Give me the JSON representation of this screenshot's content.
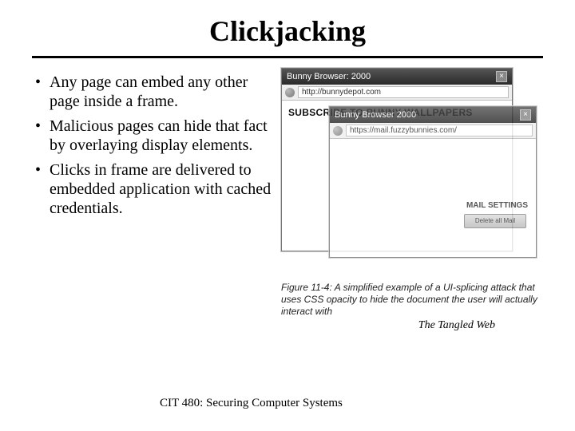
{
  "title": "Clickjacking",
  "bullets": [
    "Any page can embed any other page inside a frame.",
    "Malicious pages can hide that fact by overlaying display elements.",
    "Clicks in frame are delivered to embedded application with cached credentials."
  ],
  "figure": {
    "back_window": {
      "title": "Bunny Browser: 2000",
      "url": "http://bunnydepot.com",
      "headline": "SUBSCRIBE TO BUNNY WALLPAPERS"
    },
    "front_window": {
      "title": "Bunny Browser 2000",
      "url": "https://mail.fuzzybunnies.com/",
      "section": "MAIL SETTINGS",
      "button": "Delete all Mail"
    },
    "caption": "Figure 11-4: A simplified example of a UI-splicing attack that uses CSS opacity to hide the document the user will actually interact with",
    "attribution": "The Tangled Web"
  },
  "footer": "CIT 480: Securing Computer Systems"
}
